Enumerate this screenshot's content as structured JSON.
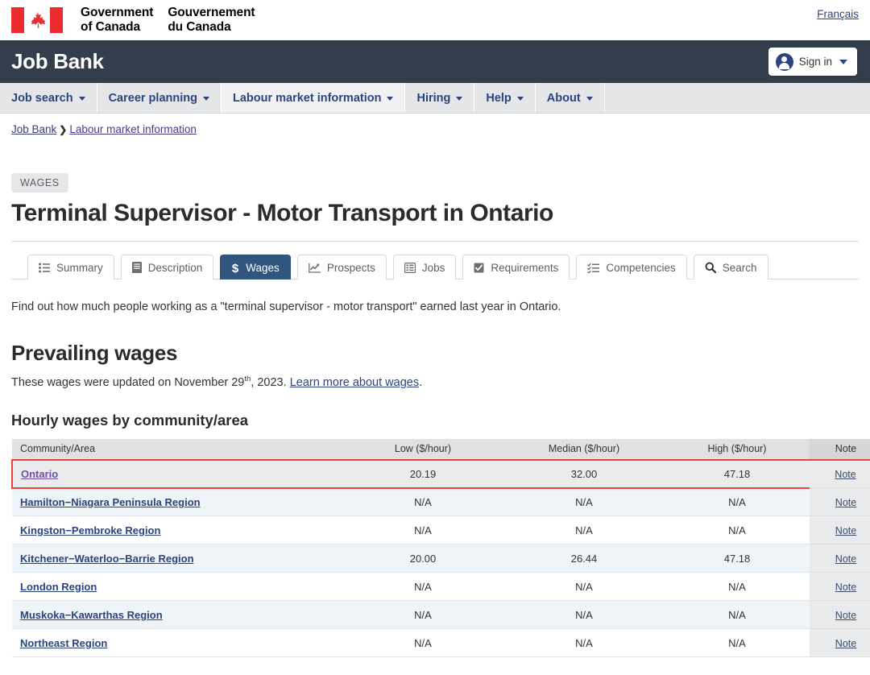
{
  "goc": {
    "wordmark_en": "Government\nof Canada",
    "wordmark_fr": "Gouvernement\ndu Canada",
    "lang_link": "Français",
    "flag_red": "#ea2d2e"
  },
  "brand": {
    "title": "Job Bank",
    "bar_color": "#343d4c",
    "signin_label": "Sign in"
  },
  "mainnav": {
    "items": [
      {
        "label": "Job search",
        "active": false
      },
      {
        "label": "Career planning",
        "active": false
      },
      {
        "label": "Labour market information",
        "active": true
      },
      {
        "label": "Hiring",
        "active": false
      },
      {
        "label": "Help",
        "active": false
      },
      {
        "label": "About",
        "active": false
      }
    ]
  },
  "breadcrumb": {
    "items": [
      "Job Bank",
      "Labour market information"
    ],
    "separator": "❯"
  },
  "page": {
    "tag": "WAGES",
    "title": "Terminal Supervisor - Motor Transport in Ontario",
    "intro": "Find out how much people working as a \"terminal supervisor - motor transport\" earned last year in Ontario."
  },
  "tabs": [
    {
      "label": "Summary",
      "icon": "list-icon",
      "active": false
    },
    {
      "label": "Description",
      "icon": "book-icon",
      "active": false
    },
    {
      "label": "Wages",
      "icon": "dollar-icon",
      "active": true
    },
    {
      "label": "Prospects",
      "icon": "chart-line-icon",
      "active": false
    },
    {
      "label": "Jobs",
      "icon": "table-icon",
      "active": false
    },
    {
      "label": "Requirements",
      "icon": "checkbox-icon",
      "active": false
    },
    {
      "label": "Competencies",
      "icon": "checklist-icon",
      "active": false
    },
    {
      "label": "Search",
      "icon": "search-icon",
      "active": false
    }
  ],
  "prevailing": {
    "heading": "Prevailing wages",
    "updated_prefix": "These wages were updated on November 29",
    "updated_sup": "th",
    "updated_mid": ", 2023. ",
    "updated_link": "Learn more about wages",
    "updated_suffix": "."
  },
  "table": {
    "title": "Hourly wages by community/area",
    "headers": [
      "Community/Area",
      "Low ($/hour)",
      "Median ($/hour)",
      "High ($/hour)",
      "Note"
    ],
    "note_label": "Note",
    "highlight_color": "#e4463f",
    "rows": [
      {
        "area": "Ontario",
        "low": "20.19",
        "median": "32.00",
        "high": "47.18",
        "note": "Note",
        "highlighted": true,
        "visited": true
      },
      {
        "area": "Hamilton−Niagara Peninsula Region",
        "low": "N/A",
        "median": "N/A",
        "high": "N/A",
        "note": "Note",
        "highlighted": false,
        "visited": false
      },
      {
        "area": "Kingston−Pembroke Region",
        "low": "N/A",
        "median": "N/A",
        "high": "N/A",
        "note": "Note",
        "highlighted": false,
        "visited": false
      },
      {
        "area": "Kitchener−Waterloo−Barrie Region",
        "low": "20.00",
        "median": "26.44",
        "high": "47.18",
        "note": "Note",
        "highlighted": false,
        "visited": false
      },
      {
        "area": "London Region",
        "low": "N/A",
        "median": "N/A",
        "high": "N/A",
        "note": "Note",
        "highlighted": false,
        "visited": false
      },
      {
        "area": "Muskoka−Kawarthas Region",
        "low": "N/A",
        "median": "N/A",
        "high": "N/A",
        "note": "Note",
        "highlighted": false,
        "visited": false
      },
      {
        "area": "Northeast Region",
        "low": "N/A",
        "median": "N/A",
        "high": "N/A",
        "note": "Note",
        "highlighted": false,
        "visited": false
      }
    ]
  }
}
